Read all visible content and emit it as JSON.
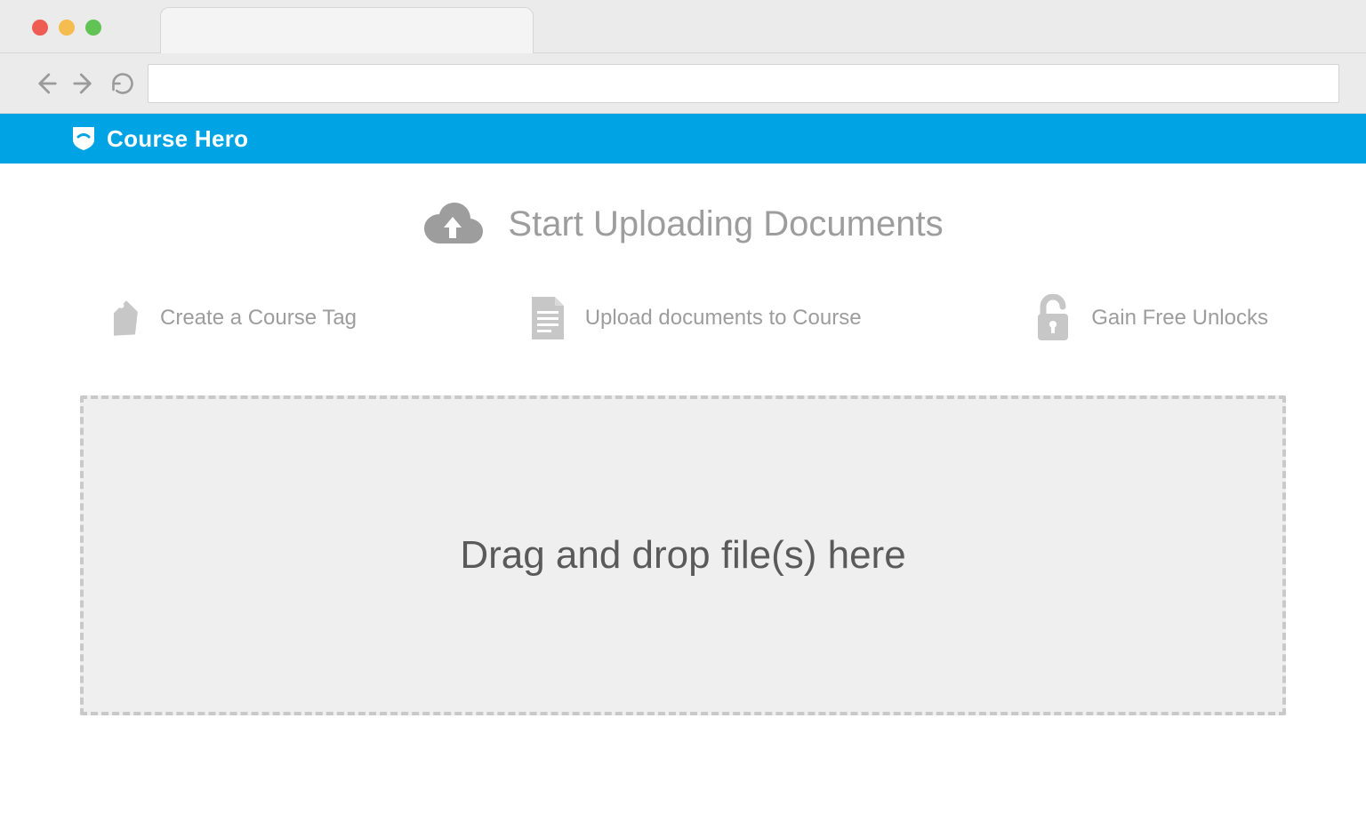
{
  "browser": {
    "url_value": ""
  },
  "header": {
    "site_name": "Course Hero"
  },
  "hero": {
    "title": "Start Uploading Documents"
  },
  "steps": [
    {
      "label": "Create a Course Tag"
    },
    {
      "label": "Upload documents to Course"
    },
    {
      "label": "Gain Free Unlocks"
    }
  ],
  "dropzone": {
    "text": "Drag and drop file(s) here"
  }
}
